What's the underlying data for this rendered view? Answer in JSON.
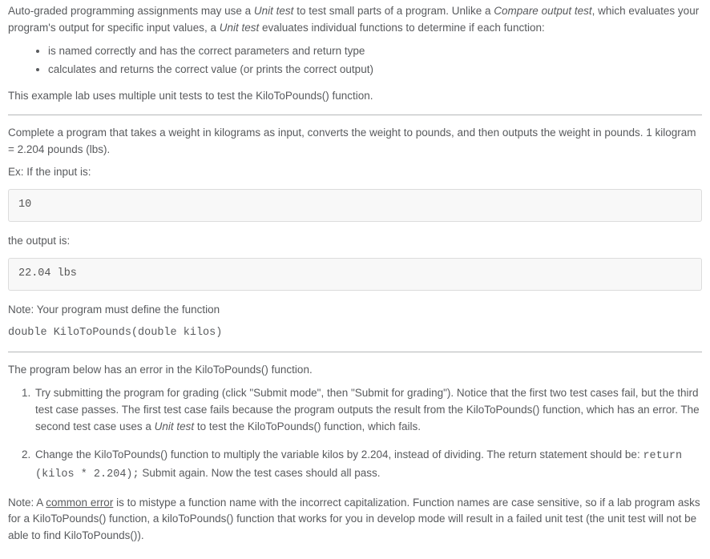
{
  "intro": {
    "p1_pre": "Auto-graded programming assignments may use a ",
    "p1_unit_test": "Unit test",
    "p1_mid1": " to test small parts of a program. Unlike a ",
    "p1_compare": "Compare output test",
    "p1_mid2": ", which evaluates your program's output for specific input values, a ",
    "p1_unit_test2": "Unit test",
    "p1_post": " evaluates individual functions to determine if each function:"
  },
  "bullets": [
    "is named correctly and has the correct parameters and return type",
    "calculates and returns the correct value (or prints the correct output)"
  ],
  "example_line": "This example lab uses multiple unit tests to test the KiloToPounds() function.",
  "task": {
    "desc": "Complete a program that takes a weight in kilograms as input, converts the weight to pounds, and then outputs the weight in pounds. 1 kilogram = 2.204 pounds (lbs).",
    "ex_input_label": "Ex: If the input is:",
    "ex_input_val": "10",
    "ex_output_label": "the output is:",
    "ex_output_val": "22.04 lbs",
    "note_prefix": "Note: Your program must define the function",
    "func_sig": "double KiloToPounds(double kilos)"
  },
  "error_section": {
    "heading": "The program below has an error in the KiloToPounds() function.",
    "steps": [
      "Try submitting the program for grading (click \"Submit mode\", then \"Submit for grading\"). Notice that the first two test cases fail, but the third test case passes. The first test case fails because the program outputs the result from the KiloToPounds() function, which has an error. The second test case uses a ",
      "Change the KiloToPounds() function to multiply the variable kilos by 2.204, instead of dividing. The return statement should be: "
    ],
    "step1_italic": "Unit test",
    "step1_tail": " to test the KiloToPounds() function, which fails.",
    "step2_code": "return (kilos * 2.204);",
    "step2_tail": " Submit again. Now the test cases should all pass.",
    "note_pre": "Note: A ",
    "note_underline": "common error",
    "note_post": " is to mistype a function name with the incorrect capitalization. Function names are case sensitive, so if a lab program asks for a KiloToPounds() function, a kiloToPounds() function that works for you in develop mode will result in a failed unit test (the unit test will not be able to find KiloToPounds())."
  }
}
